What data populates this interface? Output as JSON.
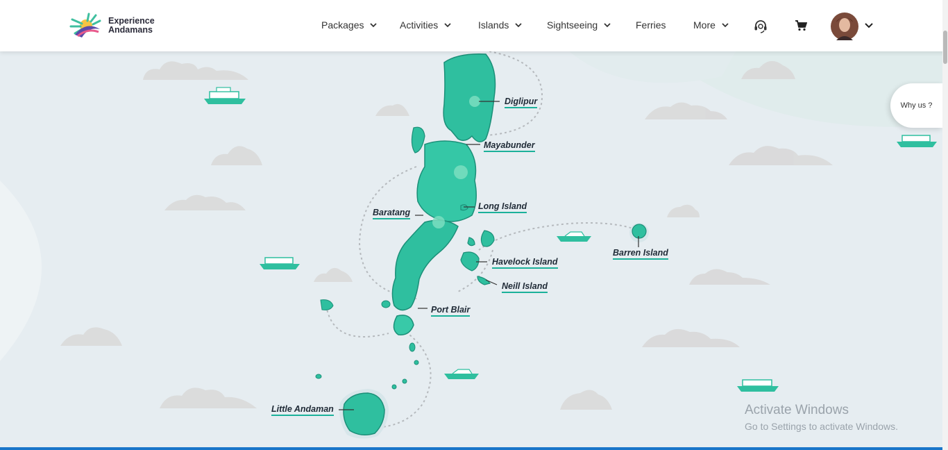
{
  "brand": {
    "line1": "Experience",
    "line2": "Andamans"
  },
  "nav": {
    "packages": "Packages",
    "activities": "Activities",
    "islands": "Islands",
    "sightseeing": "Sightseeing",
    "ferries": "Ferries",
    "more": "More"
  },
  "icons": {
    "support": "headset-icon",
    "cart": "cart-icon",
    "profile": "avatar",
    "dropdown": "chevron-down-icon"
  },
  "why_us": "Why us ?",
  "map_labels": {
    "diglipur": "Diglipur",
    "mayabunder": "Mayabunder",
    "long_island": "Long Island",
    "baratang": "Baratang",
    "havelock": "Havelock Island",
    "neill": "Neill Island",
    "barren": "Barren Island",
    "port_blair": "Port Blair",
    "little_andaman": "Little Andaman"
  },
  "watermark": {
    "title": "Activate Windows",
    "subtitle": "Go to Settings to activate Windows."
  },
  "colors": {
    "accent": "#1bb19a",
    "sea": "#e8eef2",
    "island": "#2fbf9f"
  }
}
